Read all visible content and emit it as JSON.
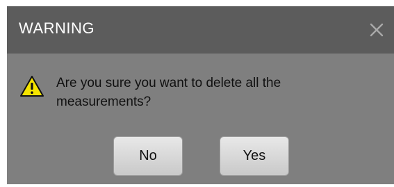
{
  "dialog": {
    "title": "WARNING",
    "close_icon": "close-icon",
    "warning_icon": "warning-triangle-icon",
    "message": "Are you sure you want to delete all the measurements?",
    "buttons": {
      "no_label": "No",
      "yes_label": "Yes"
    }
  },
  "colors": {
    "titlebar": "#5c5c5c",
    "body": "#7f7f7f",
    "warning_fill": "#f5e400"
  }
}
